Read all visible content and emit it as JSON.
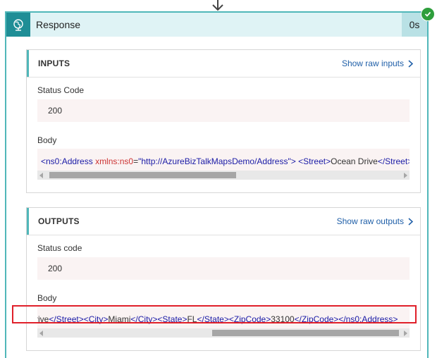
{
  "header": {
    "title": "Response",
    "duration": "0s",
    "status_icon": "check-circle-icon",
    "icon": "globe-icon"
  },
  "inputs": {
    "section_title": "INPUTS",
    "raw_link": "Show raw inputs",
    "status_label": "Status Code",
    "status_value": "200",
    "body_label": "Body",
    "body_parts": {
      "p1": "<ns0:Address",
      "p2": "xmlns:ns0",
      "p3": "=",
      "p4": "\"http://AzureBizTalkMapsDemo/Address\"",
      "p5": ">",
      "p6": "<Street>",
      "p7": "Ocean Drive",
      "p8": "</Street>"
    }
  },
  "outputs": {
    "section_title": "OUTPUTS",
    "raw_link": "Show raw outputs",
    "status_label": "Status code",
    "status_value": "200",
    "body_label": "Body",
    "body_parts": {
      "p1": "rive",
      "p2": "</Street>",
      "p3": "<City>",
      "p4": "Miami",
      "p5": "</City>",
      "p6": "<State>",
      "p7": "FL",
      "p8": "</State>",
      "p9": "<ZipCode>",
      "p10": "33100",
      "p11": "</ZipCode>",
      "p12": "</ns0:Address>"
    }
  },
  "colors": {
    "accent": "#50b7b9",
    "link": "#1f5fa8",
    "highlight": "#e0202a",
    "success": "#2e9e3c"
  }
}
